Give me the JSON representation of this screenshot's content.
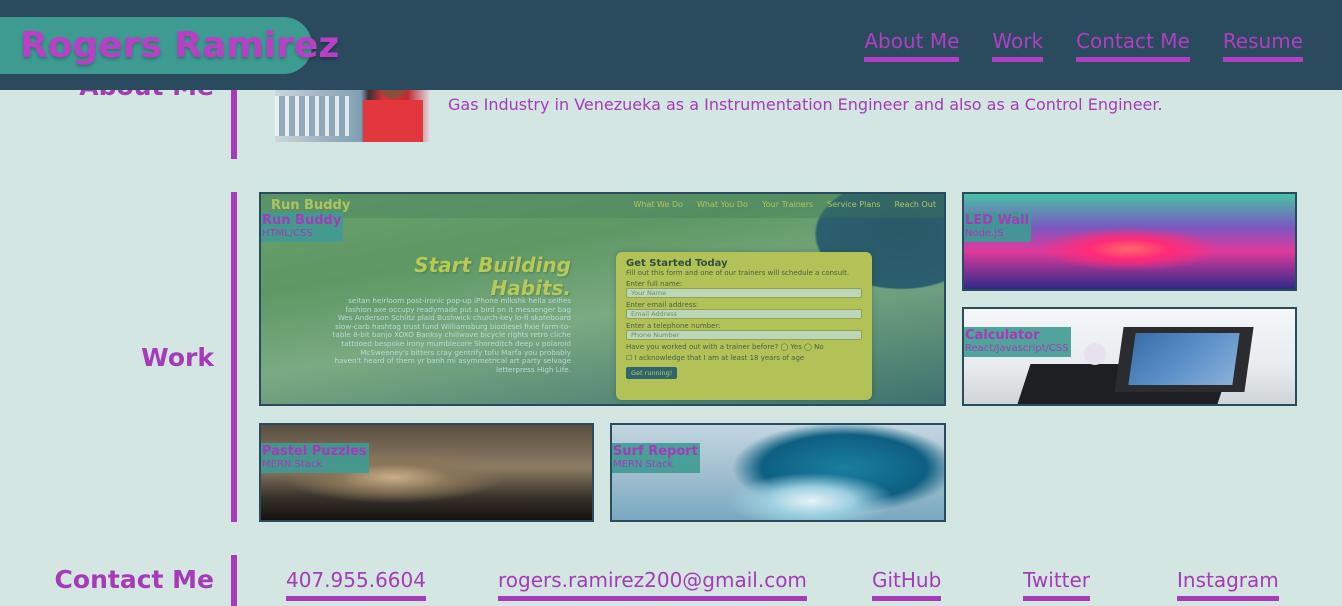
{
  "header": {
    "brand": "Rogers Ramirez",
    "nav": [
      "About Me",
      "Work",
      "Contact Me",
      "Resume"
    ]
  },
  "about": {
    "title": "About Me",
    "text": "Gas Industry in Venezueka as a Instrumentation Engineer and also as a Control Engineer."
  },
  "work": {
    "title": "Work",
    "projects": [
      {
        "name": "Run Buddy",
        "tech": "HTML/CSS"
      },
      {
        "name": "LED Wall",
        "tech": "Node.JS"
      },
      {
        "name": "Calculator",
        "tech": "React/Javascript/CSS"
      },
      {
        "name": "Pastel Puzzles",
        "tech": "MERN Stack"
      },
      {
        "name": "Surf Report",
        "tech": "MERN Stack"
      }
    ],
    "run_buddy_preview": {
      "logo": "Run Buddy",
      "menu": [
        "What We Do",
        "What You Do",
        "Your Trainers",
        "Service Plans",
        "Reach Out"
      ],
      "headline_1": "Start Building",
      "headline_2": "Habits.",
      "paragraph": "seitan heirloom post-ironic pop-up iPhone mlkshk hella selfies fashion axe occupy readymade put a bird on it messenger bag Wes Anderson Schlitz plaid Bushwick church-key lo-fi skateboard slow-carb hashtag trust fund Williamsburg biodiesel fixie farm-to-table 8-bit banjo XOXO Banksy chillwave bicycle rights retro cliche tattooed bespoke irony mumblecore Shoreditch deep v polaroid McSweeney's bitters cray gentrify tofu Marfa you probably haven't heard of them yr banh mi asymmetrical art party selvage letterpress High Life.",
      "form_title": "Get Started Today",
      "form_intro": "Fill out this form and one of our trainers will schedule a consult.",
      "fields": [
        {
          "label": "Enter full name:",
          "placeholder": "Your Name"
        },
        {
          "label": "Enter email address:",
          "placeholder": "Email Address"
        },
        {
          "label": "Enter a telephone number:",
          "placeholder": "Phone Number"
        }
      ],
      "question": "Have you worked out with a trainer before?",
      "yes": "Yes",
      "no": "No",
      "ack": "I acknowledge that I am at least 18 years of age",
      "button": "Get running!"
    }
  },
  "contact": {
    "title": "Contact Me",
    "links": [
      "407.955.6604",
      "rogers.ramirez200@gmail.com",
      "GitHub",
      "Twitter",
      "Instagram"
    ]
  },
  "colors": {
    "background": "#d3e6e2",
    "header": "#2a4a5e",
    "accent": "#a63ab8",
    "teal": "#3e9b92"
  }
}
